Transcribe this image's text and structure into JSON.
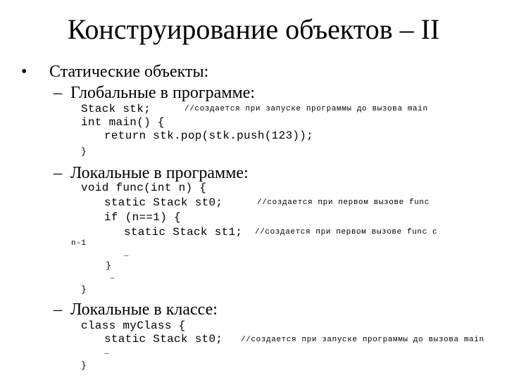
{
  "slide": {
    "title": "Конструирование объектов – II",
    "bullet": {
      "marker": "•",
      "text": "Статические объекты:"
    },
    "sections": [
      {
        "marker": "–",
        "heading": "Глобальные в программе:",
        "lines": [
          {
            "code": "Stack stk;",
            "comment": "//создается при запуске программы до вызова main"
          },
          {
            "code": "int main() {",
            "comment": ""
          },
          {
            "code": "return stk.pop(stk.push(123));",
            "comment": ""
          },
          {
            "code": "}",
            "comment": ""
          }
        ]
      },
      {
        "marker": "–",
        "heading": "Локальные в программе:",
        "lines": [
          {
            "code": "void func(int n) {",
            "comment": ""
          },
          {
            "code": "static Stack st0;",
            "comment": "//создается при первом вызове func"
          },
          {
            "code": "if (n==1) {",
            "comment": ""
          },
          {
            "code": "static Stack st1;",
            "comment": "//создается при первом вызове func с"
          },
          {
            "code": "n-1",
            "comment": ""
          },
          {
            "code": "…",
            "comment": ""
          },
          {
            "code": "}",
            "comment": ""
          },
          {
            "code": "…",
            "comment": ""
          },
          {
            "code": "}",
            "comment": ""
          }
        ]
      },
      {
        "marker": "–",
        "heading": "Локальные в классе:",
        "lines": [
          {
            "code": "class myClass {",
            "comment": ""
          },
          {
            "code": "static Stack st0;",
            "comment": "//создается при запуске программы до вызова main"
          },
          {
            "code": "…",
            "comment": ""
          },
          {
            "code": "}",
            "comment": ""
          }
        ]
      }
    ]
  }
}
